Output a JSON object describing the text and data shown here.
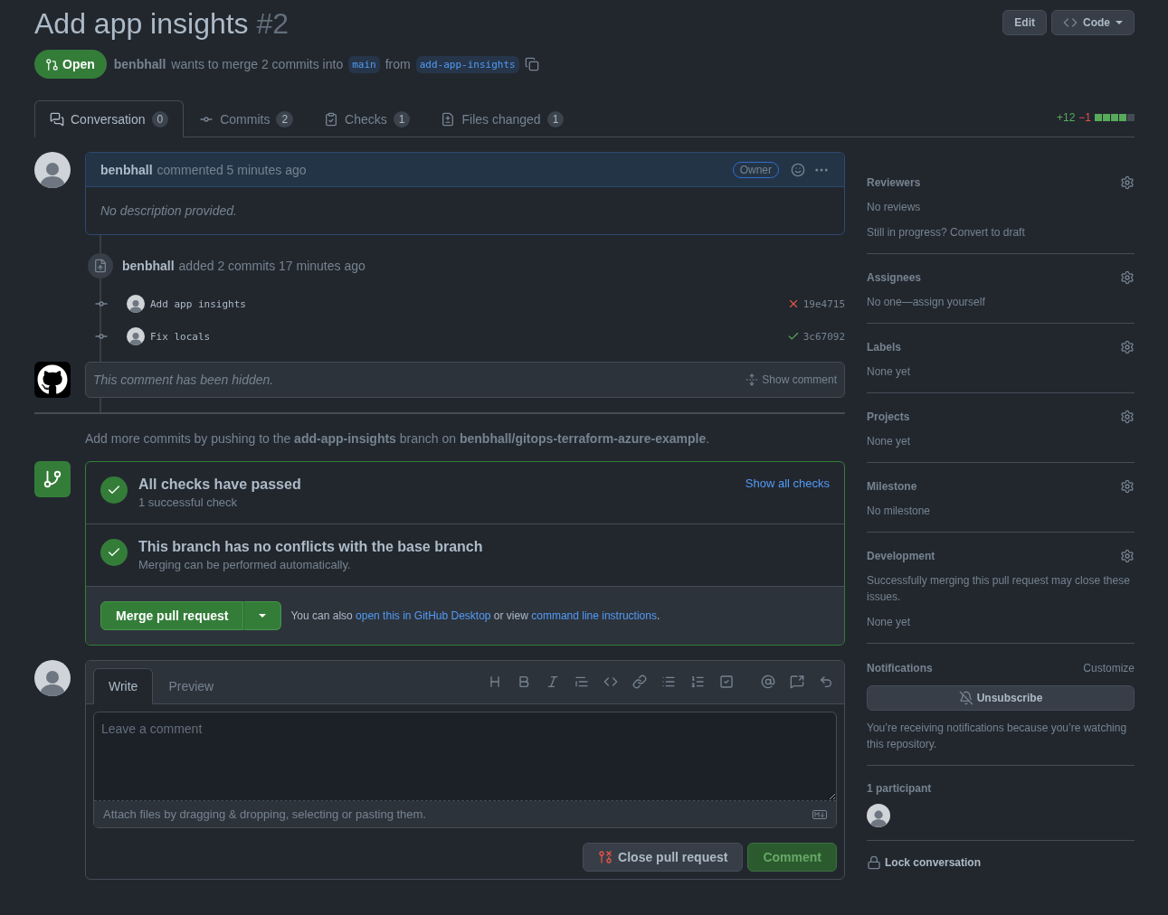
{
  "header": {
    "title": "Add app insights",
    "number": "#2",
    "edit_button": "Edit",
    "code_button": "Code"
  },
  "status": {
    "state_label": "Open",
    "author": "benbhall",
    "summary": "wants to merge 2 commits into",
    "base_branch": "main",
    "from_word": "from",
    "head_branch": "add-app-insights"
  },
  "tabs": [
    {
      "label": "Conversation",
      "count": "0",
      "selected": true
    },
    {
      "label": "Commits",
      "count": "2",
      "selected": false
    },
    {
      "label": "Checks",
      "count": "1",
      "selected": false
    },
    {
      "label": "Files changed",
      "count": "1",
      "selected": false
    }
  ],
  "diffstat": {
    "additions": "+12",
    "deletions": "−1",
    "level": 0.8
  },
  "comment": {
    "author": "benbhall",
    "action": "commented 5 minutes ago",
    "badge": "Owner",
    "body": "No description provided."
  },
  "commits_event": {
    "author": "benbhall",
    "action": "added 2 commits 17 minutes ago",
    "commits": [
      {
        "message": "Add app insights",
        "sha": "19e4715",
        "passed": false
      },
      {
        "message": "Fix locals",
        "sha": "3c67092",
        "passed": true
      }
    ]
  },
  "hidden_comment": {
    "text": "This comment has been hidden.",
    "action": "Show comment"
  },
  "push_hint": "Add more commits by pushing to the **add-app-insights** branch on **benbhall/gitops-terraform-azure-example**.",
  "merge_box": {
    "checks": [
      {
        "title": "All checks have passed",
        "subtitle": "1 successful check",
        "passed": true,
        "link": "Show all checks"
      },
      {
        "title": "This branch has no conflicts with the base branch",
        "subtitle": "Merging can be performed automatically.",
        "passed": true
      }
    ],
    "merge_button": "Merge pull request",
    "also_prefix": "You can also",
    "desktop_link": "open this in GitHub Desktop",
    "also_middle": "or view",
    "cli_link": "command line instructions",
    "also_suffix": "."
  },
  "comment_form": {
    "tabs": [
      {
        "label": "Write",
        "selected": true
      },
      {
        "label": "Preview",
        "selected": false
      }
    ],
    "placeholder": "Leave a comment",
    "attach_hint": "Attach files by dragging & dropping, selecting or pasting them.",
    "close_button": "Close pull request",
    "comment_button": "Comment"
  },
  "sidebar": {
    "sections": [
      {
        "title": "Reviewers",
        "lines": [
          "No reviews",
          "Still in progress? Convert to draft"
        ]
      },
      {
        "title": "Assignees",
        "lines": [
          "No one—assign yourself"
        ]
      },
      {
        "title": "Labels",
        "lines": [
          "None yet"
        ]
      },
      {
        "title": "Projects",
        "lines": [
          "None yet"
        ]
      },
      {
        "title": "Milestone",
        "lines": [
          "No milestone"
        ]
      },
      {
        "title": "Development",
        "lines": [
          "Successfully merging this pull request may close these issues.",
          "None yet"
        ]
      }
    ],
    "notifications": {
      "title": "Notifications",
      "customize": "Customize",
      "button": "Unsubscribe",
      "note": "You’re receiving notifications because you’re watching this repository."
    },
    "participants": {
      "title": "1 participant"
    },
    "lock": "Lock conversation"
  }
}
